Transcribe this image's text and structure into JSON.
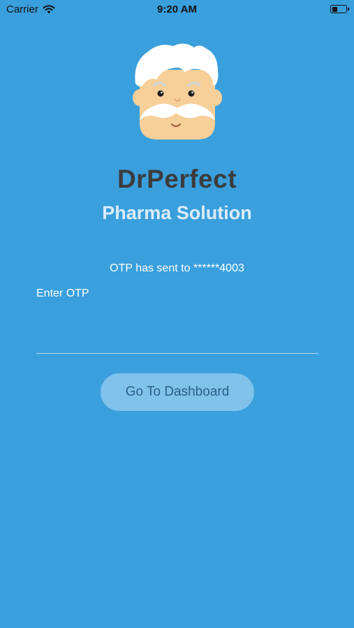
{
  "status_bar": {
    "carrier": "Carrier",
    "time": "9:20 AM",
    "wifi_icon": "wifi-icon",
    "battery_icon": "battery-icon"
  },
  "logo": {
    "icon": "doctor-avatar-icon",
    "hair_color": "#ffffff",
    "skin_color": "#f7cf99"
  },
  "app": {
    "name": "DrPerfect",
    "subtitle": "Pharma Solution"
  },
  "otp": {
    "message": "OTP has sent to ******4003",
    "label": "Enter OTP",
    "value": ""
  },
  "actions": {
    "dashboard_label": "Go To Dashboard"
  },
  "colors": {
    "background": "#3a9fdd",
    "button": "#80c2ea",
    "title": "#3c3c3c",
    "subtitle": "#dcecf8"
  }
}
